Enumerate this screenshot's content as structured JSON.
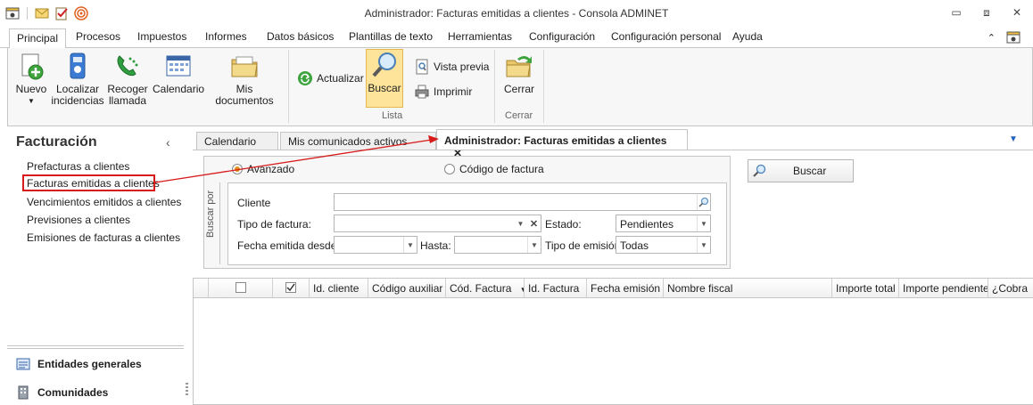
{
  "window": {
    "title": "Administrador: Facturas emitidas a clientes - Consola ADMINET",
    "qat_icons": [
      "app-icon",
      "mail-icon",
      "tasks-icon",
      "signal-icon"
    ]
  },
  "ribbon": {
    "tabs": [
      "Principal",
      "Procesos",
      "Impuestos",
      "Informes",
      "Datos básicos",
      "Plantillas de texto",
      "Herramientas",
      "Configuración",
      "Configuración personal",
      "Ayuda"
    ],
    "active_tab": "Principal",
    "buttons": {
      "nuevo": "Nuevo",
      "localizar_1": "Localizar",
      "localizar_2": "incidencias",
      "recoger_1": "Recoger",
      "recoger_2": "llamada",
      "calendario": "Calendario",
      "mis_documentos": "Mis documentos",
      "actualizar": "Actualizar",
      "buscar": "Buscar",
      "vista_previa": "Vista previa",
      "imprimir": "Imprimir",
      "cerrar": "Cerrar"
    },
    "groups": {
      "lista": "Lista",
      "cerrar": "Cerrar"
    }
  },
  "nav": {
    "title": "Facturación",
    "items": [
      "Prefacturas a clientes",
      "Facturas emitidas a clientes",
      "Vencimientos emitidos a clientes",
      "Previsiones a clientes",
      "Emisiones de facturas a clientes"
    ],
    "selected_index": 1,
    "sections": [
      "Entidades generales",
      "Comunidades"
    ]
  },
  "doc_tabs": [
    "Calendario",
    "Mis comunicados activos",
    "Administrador: Facturas emitidas a clientes"
  ],
  "search": {
    "mode_avanzado": "Avanzado",
    "mode_codigo": "Código de factura",
    "buscar_por": "Buscar por",
    "cliente_label": "Cliente",
    "cliente_value": "",
    "tipo_label": "Tipo de factura:",
    "tipo_value": "",
    "estado_label": "Estado:",
    "estado_value": "Pendientes",
    "fecha_desde_label": "Fecha emitida desde:",
    "fecha_desde_value": "",
    "hasta_label": "Hasta:",
    "hasta_value": "",
    "tipo_emision_label": "Tipo de emisión:",
    "tipo_emision_value": "Todas",
    "buscar_button": "Buscar"
  },
  "grid": {
    "columns": [
      "Id. cliente",
      "Código auxiliar",
      "Cód. Factura",
      "Id. Factura",
      "Fecha emisión",
      "Nombre fiscal",
      "Importe total",
      "Importe pendiente",
      "¿Cobra"
    ],
    "rows": []
  },
  "colors": {
    "accent_highlight": "#fde49a",
    "annotation_red": "#d81a1a",
    "radio_selected": "#e38e1a"
  }
}
